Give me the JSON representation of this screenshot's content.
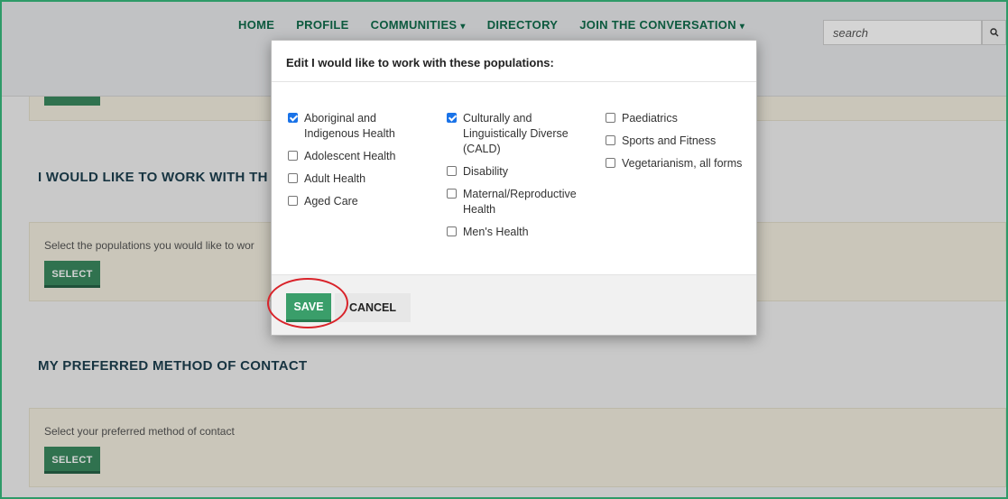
{
  "nav": {
    "items": [
      {
        "label": "HOME",
        "has_caret": false
      },
      {
        "label": "PROFILE",
        "has_caret": false
      },
      {
        "label": "COMMUNITIES",
        "has_caret": true
      },
      {
        "label": "DIRECTORY",
        "has_caret": false
      },
      {
        "label": "JOIN THE CONVERSATION",
        "has_caret": true
      }
    ],
    "caret_glyph": "▾",
    "search_placeholder": "search",
    "search_icon": "search-icon"
  },
  "sections": {
    "populations": {
      "heading": "I WOULD LIKE TO WORK WITH TH",
      "description": "Select the populations you would like to wor",
      "button": "SELECT"
    },
    "contact": {
      "heading": "MY PREFERRED METHOD OF CONTACT",
      "description": "Select your preferred method of contact",
      "button": "SELECT"
    }
  },
  "modal": {
    "title": "Edit I would like to work with these populations:",
    "columns": [
      [
        {
          "label": "Aboriginal and Indigenous Health",
          "checked": true
        },
        {
          "label": "Adolescent Health",
          "checked": false
        },
        {
          "label": "Adult Health",
          "checked": false
        },
        {
          "label": "Aged Care",
          "checked": false
        }
      ],
      [
        {
          "label": "Culturally and Linguistically Diverse (CALD)",
          "checked": true
        },
        {
          "label": "Disability",
          "checked": false
        },
        {
          "label": "Maternal/Reproductive Health",
          "checked": false
        },
        {
          "label": "Men's Health",
          "checked": false
        }
      ],
      [
        {
          "label": "Paediatrics",
          "checked": false
        },
        {
          "label": "Sports and Fitness",
          "checked": false
        },
        {
          "label": "Vegetarianism, all forms",
          "checked": false
        }
      ]
    ],
    "save_label": "SAVE",
    "cancel_label": "CANCEL"
  },
  "colors": {
    "brand_green": "#3a9e6a",
    "nav_green": "#0f6b4b",
    "checkbox_blue": "#1a73e8",
    "annotation_red": "#d9232a"
  }
}
